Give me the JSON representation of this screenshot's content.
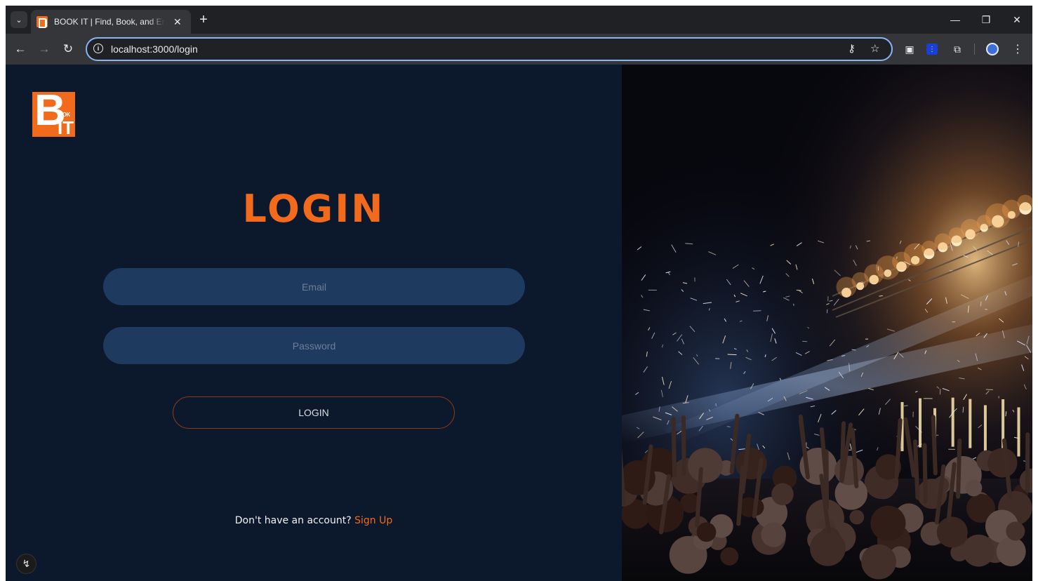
{
  "browser": {
    "tab_title": "BOOK IT | Find, Book, and Enjoy",
    "url": "localhost:3000/login",
    "icons": {
      "tab_search": "chevron-down-icon",
      "close_tab": "close-icon",
      "new_tab": "plus-icon",
      "back": "arrow-left-icon",
      "forward": "arrow-right-icon",
      "reload": "reload-icon",
      "site_info": "info-icon",
      "password_key": "key-icon",
      "bookmark": "star-icon",
      "screenshot": "camera-icon",
      "extension_blue": "extension-icon",
      "extensions": "puzzle-icon",
      "profile": "avatar-icon",
      "menu": "more-vertical-icon",
      "minimize": "minimize-icon",
      "restore": "restore-icon",
      "close_window": "close-icon"
    }
  },
  "brand": {
    "logo_letters": "BOOK IT",
    "accent_color": "#f26b1d",
    "panel_color": "#0c182b",
    "field_color": "#1e3a5f"
  },
  "login": {
    "title": "LOGIN",
    "email_placeholder": "Email",
    "password_placeholder": "Password",
    "button_label": "LOGIN",
    "signup_prompt": "Don't have an account?",
    "signup_link": "Sign Up"
  },
  "hero": {
    "subject": "concert crowd with stage lights and confetti"
  }
}
